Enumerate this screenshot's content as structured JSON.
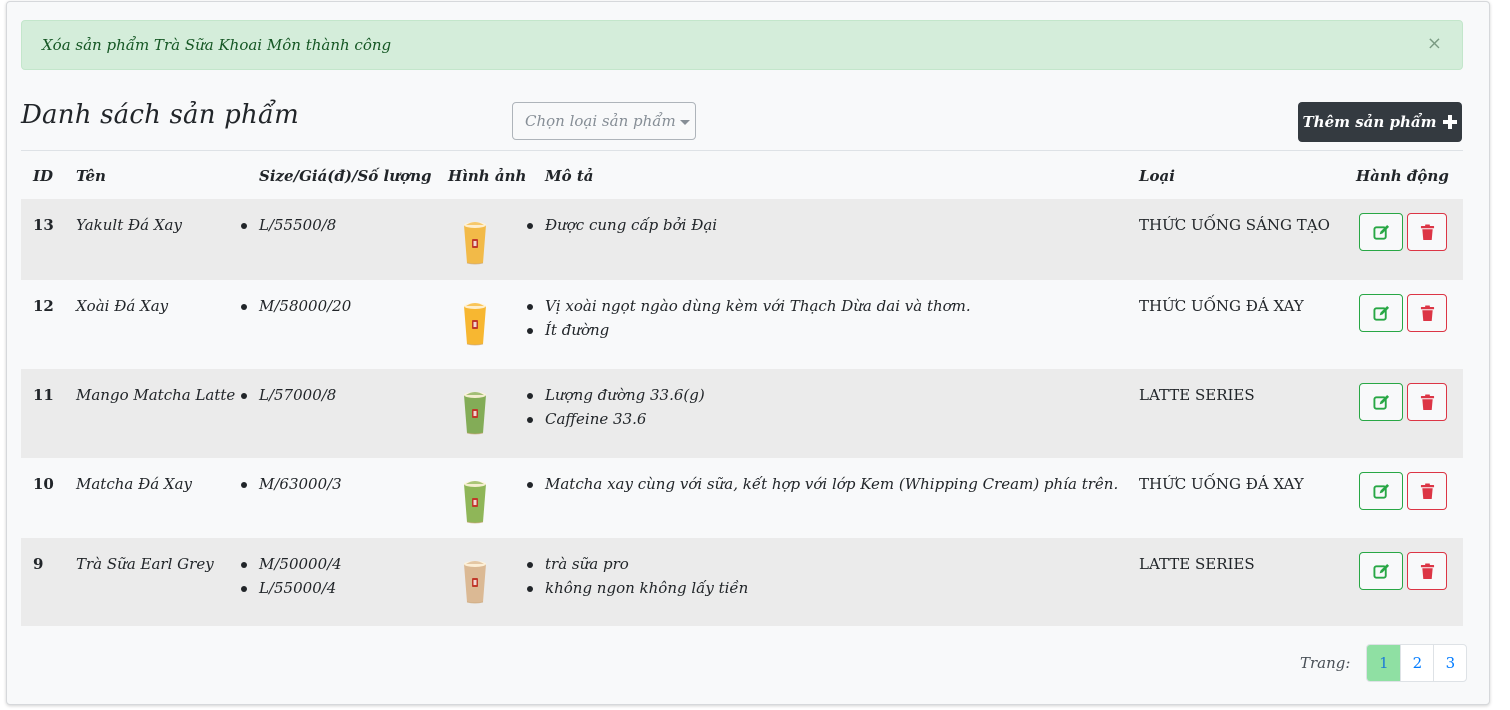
{
  "alert": {
    "message": "Xóa sản phẩm Trà Sữa Khoai Môn thành công",
    "close": "×"
  },
  "page_title": "Danh sách sản phẩm",
  "category_select": {
    "placeholder": "Chọn loại sản phẩm"
  },
  "add_button": {
    "label": "Thêm sản phẩm",
    "icon": "plus-icon"
  },
  "table": {
    "headers": {
      "id": "ID",
      "name": "Tên",
      "size": "Size/Giá(đ)/Số lượng",
      "image": "Hình ảnh",
      "desc": "Mô tả",
      "category": "Loại",
      "actions": "Hành động"
    },
    "rows": [
      {
        "id": "13",
        "name": "Yakult Đá Xay",
        "sizes": [
          "L/55500/8"
        ],
        "desc": [
          "Được cung cấp bởi Đại"
        ],
        "category": "THỨC UỐNG SÁNG TẠO",
        "image": "yakult-drink",
        "color": "#f2b53a"
      },
      {
        "id": "12",
        "name": "Xoài Đá Xay",
        "sizes": [
          "M/58000/20"
        ],
        "desc": [
          "Vị xoài ngọt ngào dùng kèm với Thạch Dừa dai và thơm.",
          "Ít đường"
        ],
        "category": "THỨC UỐNG ĐÁ XAY",
        "image": "mango-drink",
        "color": "#f6b11f"
      },
      {
        "id": "11",
        "name": "Mango Matcha Latte",
        "sizes": [
          "L/57000/8"
        ],
        "desc": [
          "Lượng đường 33.6(g)",
          "Caffeine 33.6"
        ],
        "category": "LATTE SERIES",
        "image": "mango-matcha-drink",
        "color": "#7aa64a"
      },
      {
        "id": "10",
        "name": "Matcha Đá Xay",
        "sizes": [
          "M/63000/3"
        ],
        "desc": [
          "Matcha xay cùng với sữa, kết hợp với lớp Kem (Whipping Cream) phía trên."
        ],
        "category": "THỨC UỐNG ĐÁ XAY",
        "image": "matcha-drink",
        "color": "#86b04a"
      },
      {
        "id": "9",
        "name": "Trà Sữa Earl Grey",
        "sizes": [
          "M/50000/4",
          "L/55000/4"
        ],
        "desc": [
          "trà sữa pro",
          "không ngon không lấy tiền"
        ],
        "category": "LATTE SERIES",
        "image": "earl-grey-drink",
        "color": "#d9b48c"
      }
    ]
  },
  "pagination": {
    "label": "Trang:",
    "pages": [
      "1",
      "2",
      "3"
    ],
    "current": "1"
  },
  "colors": {
    "edit": "#28a745",
    "delete": "#dc3545",
    "dark_button": "#343a40",
    "alert_bg": "#d4edda"
  }
}
